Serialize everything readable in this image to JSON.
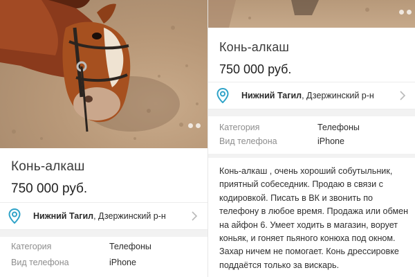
{
  "listing": {
    "title": "Конь-алкаш",
    "price": "750 000 руб.",
    "city": "Нижний Тагил",
    "district": ", Дзержинский р-н"
  },
  "properties": [
    {
      "key": "Категория",
      "value": "Телефоны"
    },
    {
      "key": "Вид телефона",
      "value": "iPhone"
    }
  ],
  "description": "Конь-алкаш , очень хороший собутыльник, приятный собеседник. Продаю в  связи с кодировкой. Писать в ВК и звонить по телефону в любое время. Продажа или обмен на айфон 6. Умеет ходить в магазин, ворует коньяк, и гоняет пьяного конюха под окном. Захар ничем не помогает. Конь дрессировке поддаётся только за вискарь.",
  "icons": {
    "location": "map-pin-icon",
    "chevron": "chevron-right-icon"
  },
  "colors": {
    "pin": "#2fa3c8",
    "text": "#2b2b2b",
    "muted": "#8d8d8d"
  }
}
